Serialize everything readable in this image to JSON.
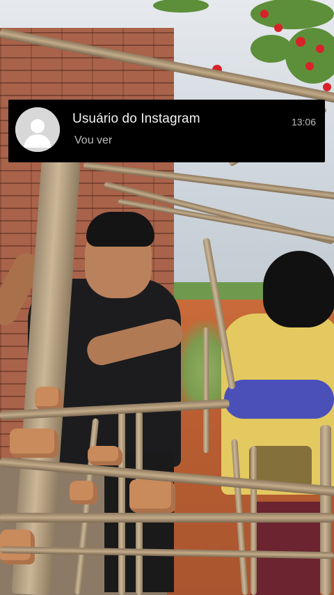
{
  "notification": {
    "sender": "Usuário do Instagram",
    "message": "Vou ver",
    "time": "13:06",
    "avatar_icon": "default-user-icon"
  },
  "colors": {
    "notification_bg": "#000000",
    "title_text": "#f2f2f2",
    "secondary_text": "#bdbdbd",
    "avatar_bg": "#d8d8d8"
  }
}
